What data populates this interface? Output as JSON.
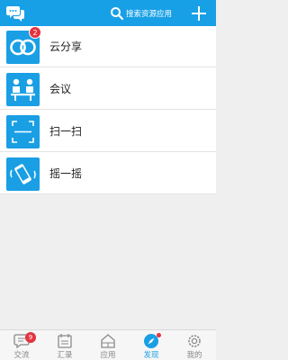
{
  "topbar": {
    "search_label": "搜索资源应用"
  },
  "list": [
    {
      "label": "云分享",
      "badge": "2"
    },
    {
      "label": "会议"
    },
    {
      "label": "扫一扫"
    },
    {
      "label": "摇一摇"
    }
  ],
  "bottom_nav": [
    {
      "label": "交流",
      "badge": "9"
    },
    {
      "label": "汇录"
    },
    {
      "label": "应用"
    },
    {
      "label": "发现",
      "active": true
    },
    {
      "label": "我的"
    }
  ],
  "colors": {
    "primary": "#18a0e6",
    "badge": "#e3333f",
    "tab_inactive": "#8a8a8a"
  },
  "icons": {
    "chat": "chat-bubbles-icon",
    "search": "search-icon",
    "plus": "plus-icon",
    "cloud_share": "cloud-share-rings-icon",
    "meeting": "meeting-people-icon",
    "scan": "scan-frame-icon",
    "shake": "shake-phone-icon"
  }
}
